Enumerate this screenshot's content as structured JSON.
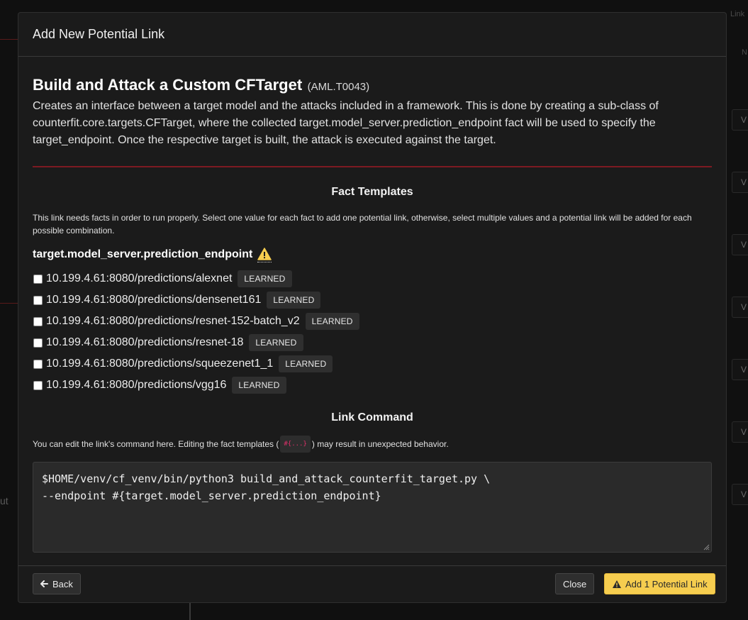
{
  "modal": {
    "header_title": "Add New Potential Link",
    "ability_title": "Build and Attack a Custom CFTarget",
    "ability_id": "(AML.T0043)",
    "description": "Creates an interface between a target model and the attacks included in a framework. This is done by creating a sub-class of counterfit.core.targets.CFTarget, where the collected target.model_server.prediction_endpoint fact will be used to specify the target_endpoint. Once the respective target is built, the attack is executed against the target.",
    "accent_color": "#7d1a22"
  },
  "fact_templates": {
    "title": "Fact Templates",
    "help": "This link needs facts in order to run properly. Select one value for each fact to add one potential link, otherwise, select multiple values and a potential link will be added for each possible combination.",
    "fact_name": "target.model_server.prediction_endpoint",
    "warning_icon": "warning-icon",
    "options": [
      {
        "value": "10.199.4.61:8080/predictions/alexnet",
        "tag": "LEARNED",
        "checked": false
      },
      {
        "value": "10.199.4.61:8080/predictions/densenet161",
        "tag": "LEARNED",
        "checked": false
      },
      {
        "value": "10.199.4.61:8080/predictions/resnet-152-batch_v2",
        "tag": "LEARNED",
        "checked": false
      },
      {
        "value": "10.199.4.61:8080/predictions/resnet-18",
        "tag": "LEARNED",
        "checked": false
      },
      {
        "value": "10.199.4.61:8080/predictions/squeezenet1_1",
        "tag": "LEARNED",
        "checked": false
      },
      {
        "value": "10.199.4.61:8080/predictions/vgg16",
        "tag": "LEARNED",
        "checked": false
      }
    ]
  },
  "link_command": {
    "title": "Link Command",
    "help_before": "You can edit the link's command here. Editing the fact templates (",
    "help_code": "#{...}",
    "help_after": ") may result in unexpected behavior.",
    "command": "$HOME/venv/cf_venv/bin/python3 build_and_attack_counterfit_target.py \\\n--endpoint #{target.model_server.prediction_endpoint}"
  },
  "footer": {
    "back_label": "Back",
    "close_label": "Close",
    "add_label": "Add 1 Potential Link",
    "add_color": "#f6cd4f"
  },
  "background": {
    "fragment_text": "ut",
    "right_top": "Link",
    "right_n": "N",
    "right_btn_label": "V"
  }
}
